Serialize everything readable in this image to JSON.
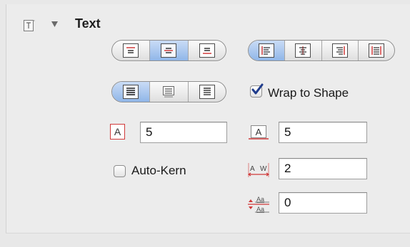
{
  "section": {
    "title": "Text",
    "inspector_icon": "text-inspector-icon",
    "disclosure_icon": "disclosure-triangle-down-icon"
  },
  "vertical_alignment": {
    "options": [
      "top",
      "middle",
      "bottom"
    ],
    "selected": "middle"
  },
  "horizontal_alignment": {
    "options": [
      "left",
      "center",
      "right",
      "justify"
    ],
    "selected": "left"
  },
  "text_style_group": {
    "options": [
      "style-1",
      "style-2",
      "style-3"
    ],
    "selected": "style-1"
  },
  "wrap_to_shape": {
    "label": "Wrap to Shape",
    "checked": true
  },
  "auto_kern": {
    "label": "Auto-Kern",
    "checked": false
  },
  "fields": {
    "left_text_size": "5",
    "right_text_size": "5",
    "kerning": "2",
    "baseline_shift": "0"
  },
  "icons": {
    "left_size": "text-size-icon",
    "right_size": "text-size-icon",
    "kerning": "kerning-icon",
    "baseline": "baseline-shift-icon"
  },
  "colors": {
    "selected_segment": "#90b6e8",
    "accent_red": "#d03a3a"
  }
}
